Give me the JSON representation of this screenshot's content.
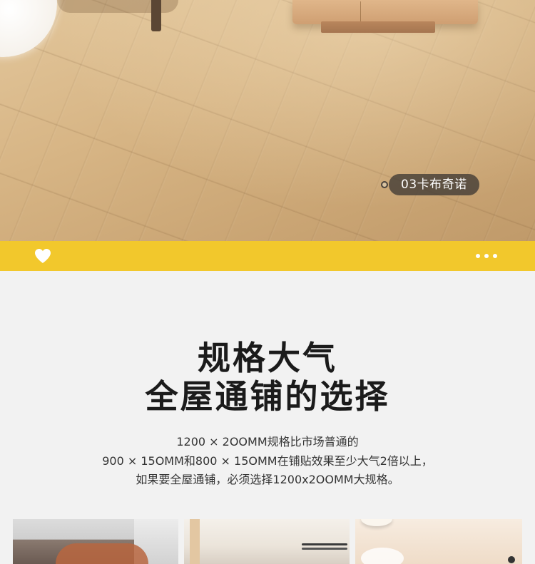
{
  "hero": {
    "tag_label": "03卡布奇诺"
  },
  "action_bar": {
    "bg_color": "#f2c82c",
    "heart_icon": "heart-icon",
    "more_icon": "more-dots-icon"
  },
  "headline": {
    "line1": "规格大气",
    "line2": "全屋通铺的选择"
  },
  "description": {
    "line1": "1200 × 2OOMM规格比市场普通的",
    "line2": "900 × 15OMM和800 × 15OMM在铺贴效果至少大气2倍以上，",
    "line3": "如果要全屋通铺，必须选择1200x2OOMM大规格。"
  }
}
